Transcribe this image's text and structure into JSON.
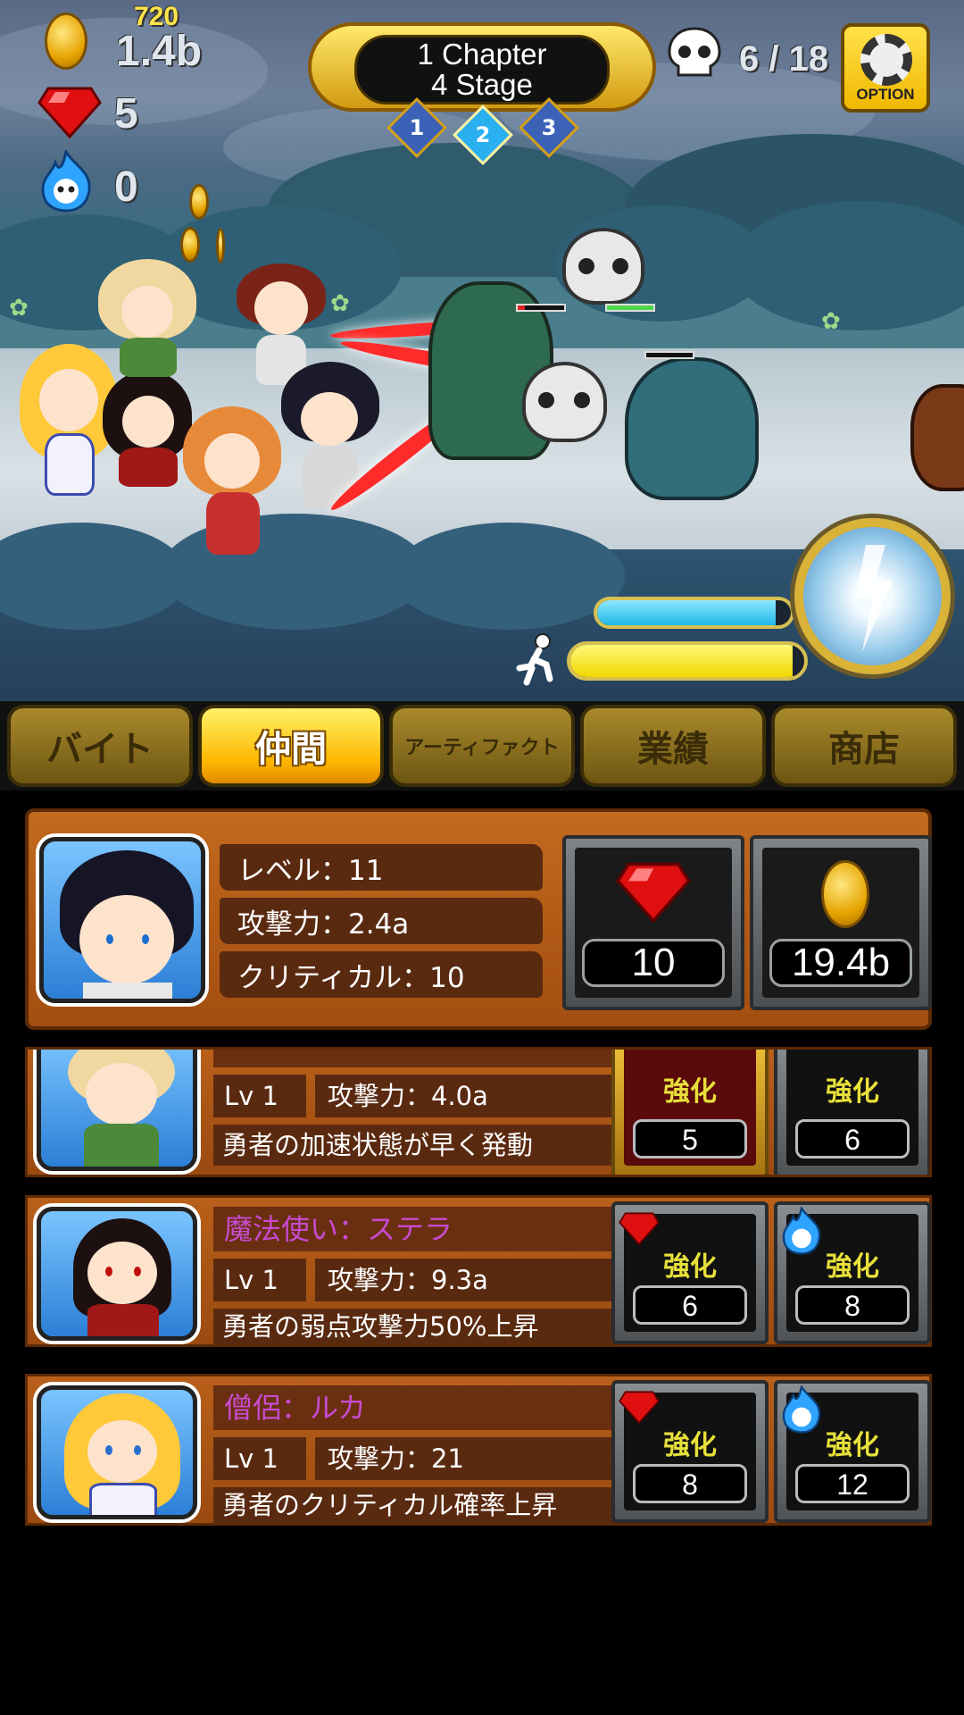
{
  "hud": {
    "gold_top": "720",
    "gold": "1.4b",
    "gems": "5",
    "souls": "0",
    "kills": "6 / 18",
    "option_label": "OPTION"
  },
  "stage": {
    "chapter": "1 Chapter",
    "stage": "4 Stage",
    "markers": [
      "1",
      "2",
      "3"
    ],
    "current_marker": "2"
  },
  "bars": {
    "skill_gauge": 0.92,
    "run_gauge": 0.95
  },
  "tabs": [
    {
      "label": "バイト",
      "active": false
    },
    {
      "label": "仲間",
      "active": true
    },
    {
      "label": "アーティファクト",
      "active": false
    },
    {
      "label": "業績",
      "active": false
    },
    {
      "label": "商店",
      "active": false
    }
  ],
  "hero_detail": {
    "level": "レベル：11",
    "attack": "攻撃力：2.4a",
    "critical": "クリティカル：10",
    "gem_cost": "10",
    "gold_cost": "19.4b"
  },
  "companions": [
    {
      "name": "",
      "level": "Lv 1",
      "attack": "攻撃力：4.0a",
      "desc": "勇者の加速状態が早く発動",
      "up_label": "強化",
      "gem_cost": "5",
      "soul_cost": "6"
    },
    {
      "name": "魔法使い：ステラ",
      "level": "Lv 1",
      "attack": "攻撃力：9.3a",
      "desc": "勇者の弱点攻撃力50%上昇",
      "up_label": "強化",
      "gem_cost": "6",
      "soul_cost": "8"
    },
    {
      "name": "僧侶：ルカ",
      "level": "Lv 1",
      "attack": "攻撃力：21",
      "desc": "勇者のクリティカル確率上昇",
      "up_label": "強化",
      "gem_cost": "8",
      "soul_cost": "12"
    }
  ],
  "colors": {
    "gold": "#f0b800",
    "name_text": "#c84bd0",
    "upgrade_text": "#e8e03a",
    "panel": "#a34d10"
  }
}
